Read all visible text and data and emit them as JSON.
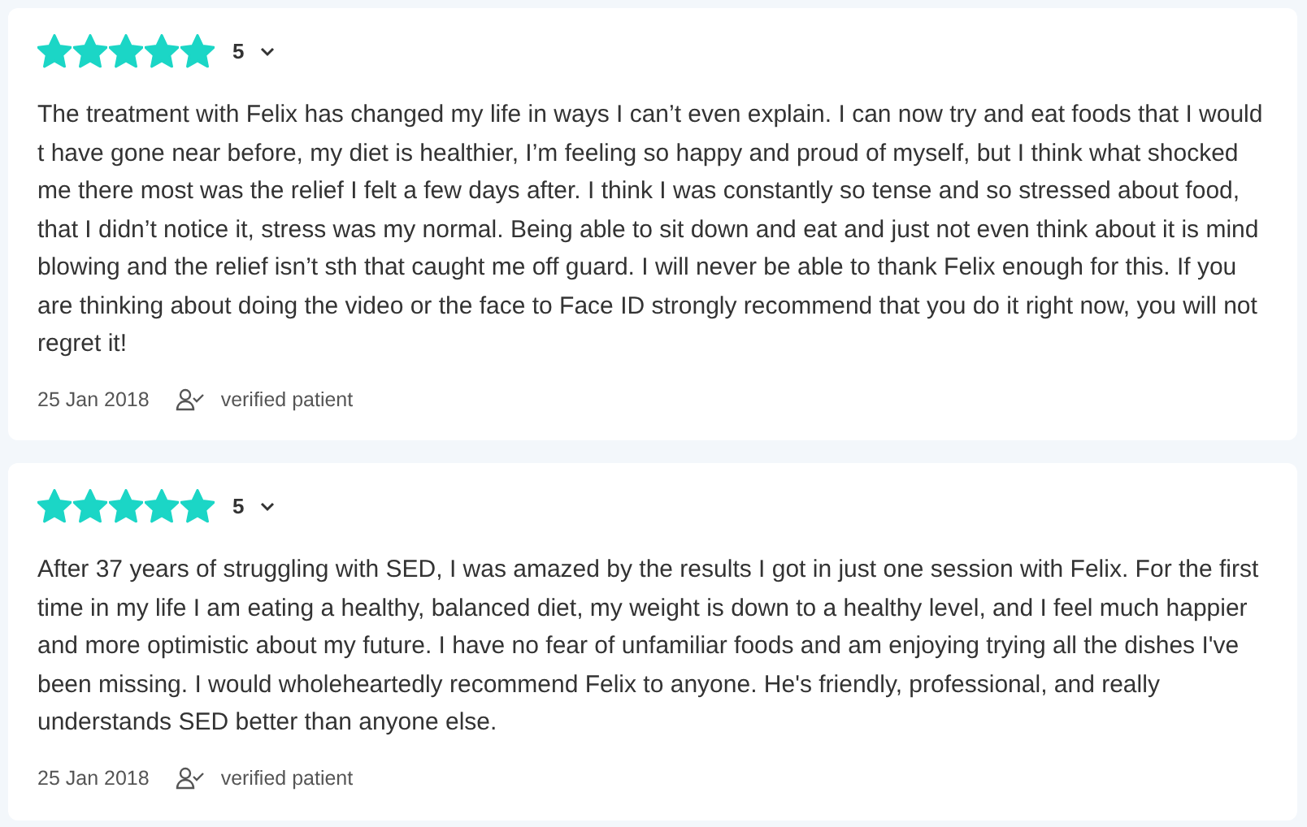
{
  "reviews": [
    {
      "stars": 5,
      "rating": "5",
      "text": "The treatment with Felix has changed my life in ways I can’t even explain. I can now try and eat foods that I would t have gone near before, my diet is healthier, I’m feeling so happy and proud of myself, but I think what shocked me there most was the relief I felt a few days after. I think I was constantly so tense and so stressed about food, that I didn’t notice it, stress was my normal. Being able to sit down and eat and just not even think about it is mind blowing and the relief isn’t sth that caught me off guard. I will never be able to thank Felix enough for this. If you are thinking about doing the video or the face to Face ID strongly recommend that you do it right now, you will not regret it!",
      "date": "25 Jan 2018",
      "verified": "verified patient"
    },
    {
      "stars": 5,
      "rating": "5",
      "text": "After 37 years of struggling with SED, I was amazed by the results I got in just one session with Felix. For the first time in my life I am eating a healthy, balanced diet, my weight is down to a healthy level, and I feel much happier and more optimistic about my future. I have no fear of unfamiliar foods and am enjoying trying all the dishes I've been missing. I would wholeheartedly recommend Felix to anyone. He's friendly, professional, and really understands SED better than anyone else.",
      "date": "25 Jan 2018",
      "verified": "verified patient"
    }
  ]
}
